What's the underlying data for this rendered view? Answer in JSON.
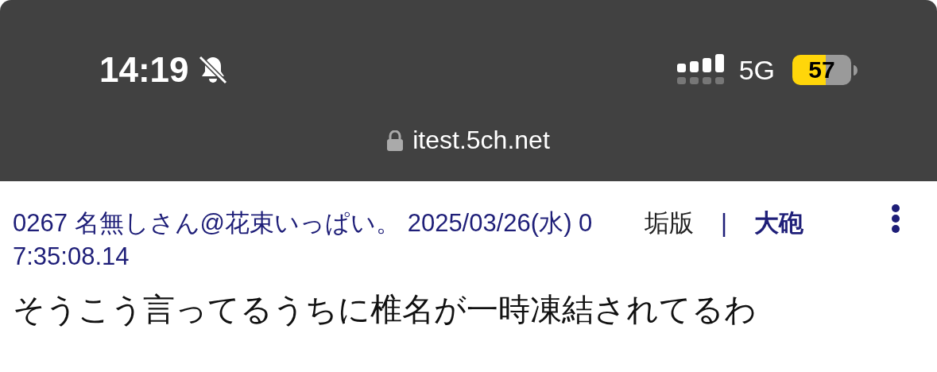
{
  "status_bar": {
    "time": "14:19",
    "network": "5G",
    "battery": "57"
  },
  "address_bar": {
    "url": "itest.5ch.net"
  },
  "post": {
    "header": "0267 名無しさん@花束いっぱい。 2025/03/26(水) 07:35:08.14",
    "actions": [
      {
        "kind": "link",
        "label": "垢版"
      },
      {
        "kind": "separator",
        "label": "|"
      },
      {
        "kind": "strong",
        "label": "大砲"
      }
    ],
    "body": "そうこう言ってるうちに椎名が一時凍結されてるわ"
  }
}
